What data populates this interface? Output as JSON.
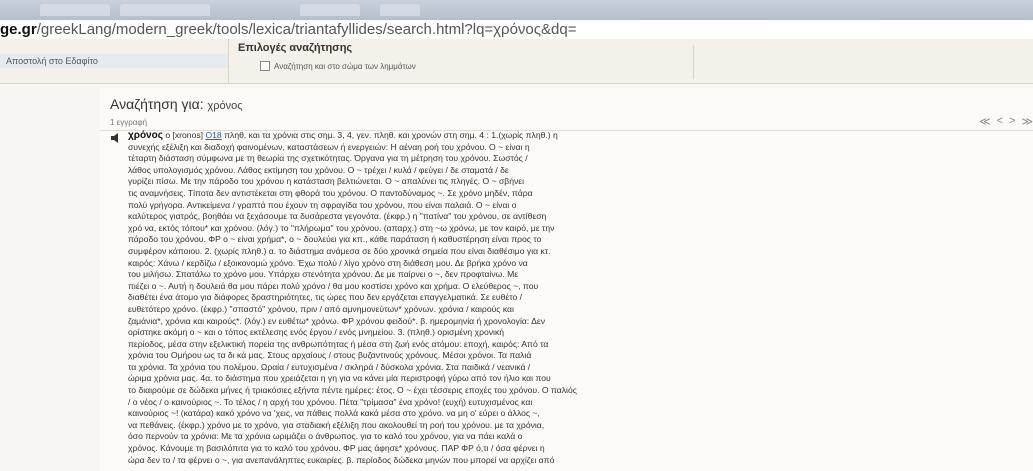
{
  "browser": {
    "address_host": "ge.gr",
    "address_path": "/greekLang/modern_greek/tools/lexica/triantafyllides/search.html?lq=χρόνος&dq="
  },
  "sidebar": {
    "line1": "",
    "link": "Αποστολή στο Εδαφίτο"
  },
  "options": {
    "title": "Επιλογές αναζήτησης",
    "checkbox_label": "Αναζήτηση και στο σώμα των λημμάτων",
    "checked": false
  },
  "results": {
    "search_label": "Αναζήτηση για:",
    "query": "χρόνος",
    "count": "1 εγγραφή",
    "pager": [
      "≪",
      "<",
      ">",
      "≫"
    ]
  },
  "entry": {
    "headword": "χρόνος",
    "pron": "ο [xronos]",
    "ref": "Ο18",
    "lines": [
      "πληθ. και τα χρόνια στις σημ. 3, 4, γεν. πληθ. και χρονών στη σημ. 4 : 1.(χωρίς πληθ.) η",
      "συνεχής εξέλιξη και διαδοχή φαινομένων, καταστάσεων ή ενεργειών: Η αέναη ροή του χρόνου. Ο ~ είναι η",
      "τέταρτη διάσταση σύμφωνα με τη θεωρία της σχετικότητας. Όργανα για τη μέτρηση του χρόνου. Σωστός /",
      "λάθος υπολογισμός χρόνου. Λάθος εκτίμηση του χρόνου. Ο ~ τρέχει / κυλά / φεύγει / δε σταματά / δε",
      "γυρίζει πίσω. Με την πάροδο του χρόνου η κατάσταση βελτιώνεται. Ο ~ απαλύνει τις πληγές. Ο ~ σβήνει",
      "τις αναμνήσεις. Τίποτα δεν αντιστέκεται στη φθορά του χρόνου. Ο παντοδύναμος ~. Σε χρόνο μηδέν, πάρα",
      "πολύ γρήγορα. Αντικείμενα / γραπτά που έχουν τη σφραγίδα του χρόνου, που είναι παλαιά. Ο ~ είναι ο",
      "καλύτερος γιατρός, βοηθάει να ξεχάσουμε τα δυσάρεστα γεγονότα. (έκφρ.) η \"πατίνα\" του χρόνου, σε αντίθεση",
      "χρό να, εκτός τόπου* και χρόνου. (λόγ.) το \"πλήρωμα\" του χρόνου. (απαρχ.) στη ~ω χρόνω, με τον καιρό, με την",
      "πάροδο του χρόνου. ΦΡ ο ~ είναι χρήμα*, ο ~ δουλεύει για κπ., κάθε παράταση ή καθυστέρηση είναι προς το",
      "συμφέρον κάποιου. 2. (χωρίς πληθ.) α. το διάστημα ανάμεσα σε δύο χρονικά σημεία που είναι διαθέσιμο για κτ.",
      "καιρός: Χάνω / κερδίζω / εξοικονομώ χρόνο. Έχω πολύ / λίγο χρόνο στη διάθεση μου. Δε βρήκα χρόνο να",
      "του μιλήσω. Σπατάλω το χρόνο μου. Υπάρχει στενότητα χρόνου. Δε με παίρνει ο ~, δεν προφταίνω. Με",
      "πιέζει ο ~. Αυτή η δουλειά θα μου πάρει πολύ χρόνο / θα μου κοστίσει χρόνο και χρήμα. Ο ελεύθερος ~, που",
      "διαθέτει ένα άτομο για διάφορες δραστηριότητες, τις ώρες που δεν εργάζεται επαγγελματικά. Σε ευθέτο /",
      "ευθετότερο χρόνο. (έκφρ.) \"σπαστό\" χρόνου, πριν / από αμνημονεύτων* χρόνων. χρόνια / καιρούς και",
      "ζαμάνια*, χρόνια και καιρούς*. (λόγ.) εν ευθέτω* χρόνω. ΦΡ χρόνου φειδού*. β. ημερομηνία ή χρονολογία: Δεν",
      "ορίστηκε ακόμη ο ~ και ο τόπος εκτέλεσης ενός έργου / ενός μνημείου. 3. (πληθ.) ορισμένη χρονική",
      "περίοδος, μέσα στην εξελικτική πορεία της ανθρωπότητας ή μέσα στη ζωή ενός ατόμου: εποχή, καιρός: Από τα",
      "χρόνια του Ομήρου ως τα δι κά μας. Στους αρχαίους / στους βυζαντινούς χρόνους. Μέσοι χρόνοι. Τα παλιά",
      "τα χρόνια. Τα χρόνια του πολέμου. Ωραία / ευτυχισμένα / σκληρά / δύσκολα χρόνια. Στα παιδικά / νεανικά /",
      "ώριμα χρόνια μας. 4α. το διάστημα που χρειάζεται η γη για να κάνει μία περιστροφή γύρω από τον ήλιο και που",
      "το διαιρούμε σε δώδεκα μήνες ή τριακόσιες εξήντα πέντε ημέρες: έτος. Ο ~ έχει τέσσερις εποχές του χρόνου. Ο παλιός",
      "/ ο νέος / ο καινούριος ~. Το τέλος / η αρχή του χρόνου. Πέτα \"τρίμασα\" ένα χρόνο! (ευχή) ευτυχισμένος και",
      "καινούριος ~! (κατάρα) κακό χρόνο να 'χεις, να πάθεις πολλά κακά μέσα στο χρόνο. να μη ο' εύρει ο άλλος ~,",
      "να πεθάνεις. (έκφρ.) χρόνο με το χρόνο, για σταδιακή εξέλιξη που ακολουθεί τη ροή του χρόνου. με τα χρόνια,",
      "όσο περνούν τα χρόνια: Με τα χρόνια ωριμάζει ο άνθρωπος. για το καλό του χρόνου, για να πάει καλά ο",
      "χρόνος. Κάνουμε τη βασιλόπιτα για το καλό του χρόνου. ΦΡ μας άφησε* χρόνους. ΠΑΡ ΦΡ ό,τι / όσα φέρνει η",
      "ώρα δεν το / τα φέρνει ο ~, για ανεπανάληπτες ευκαιρίες. β. περίοδος δώδεκα μηνών που μπορεί να αρχίζει από"
    ]
  }
}
